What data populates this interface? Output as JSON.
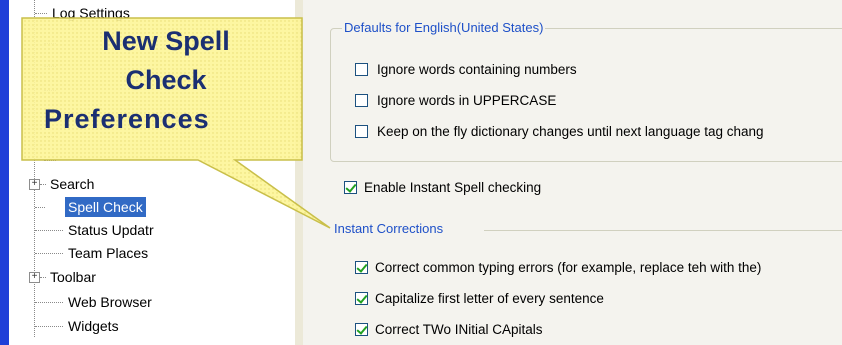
{
  "tree": {
    "items": [
      {
        "label": "Log Settings",
        "expander": ""
      },
      {
        "label": "Search",
        "expander": "+"
      },
      {
        "label": "Spell Check",
        "expander": "",
        "selected": true
      },
      {
        "label": "Status Updatr",
        "expander": ""
      },
      {
        "label": "Team Places",
        "expander": ""
      },
      {
        "label": "Toolbar",
        "expander": "+"
      },
      {
        "label": "Web Browser",
        "expander": ""
      },
      {
        "label": "Widgets",
        "expander": ""
      }
    ]
  },
  "callout": {
    "line1": "New Spell",
    "line2": "Check",
    "line3": "Preferences"
  },
  "defaults": {
    "title": "Defaults for English(United States)",
    "options": [
      {
        "label": "Ignore words containing numbers",
        "checked": false
      },
      {
        "label": "Ignore words in UPPERCASE",
        "checked": false
      },
      {
        "label": "Keep on the fly dictionary changes until next language tag chang",
        "checked": false
      }
    ]
  },
  "enable_instant": {
    "label": "Enable Instant Spell checking",
    "checked": true
  },
  "instant_corrections": {
    "title": "Instant Corrections",
    "options": [
      {
        "label": "Correct common typing errors (for example, replace teh with the)",
        "checked": true
      },
      {
        "label": "Capitalize first letter of every sentence",
        "checked": true
      },
      {
        "label": "Correct TWo INitial CApitals",
        "checked": true
      }
    ]
  },
  "colors": {
    "accent_bar": "#1f3fd8",
    "selection": "#316ac5",
    "group_title": "#1e50c8",
    "callout_fill": "#fdf59a",
    "callout_text": "#1b2f72",
    "checkmark": "#21a121"
  }
}
